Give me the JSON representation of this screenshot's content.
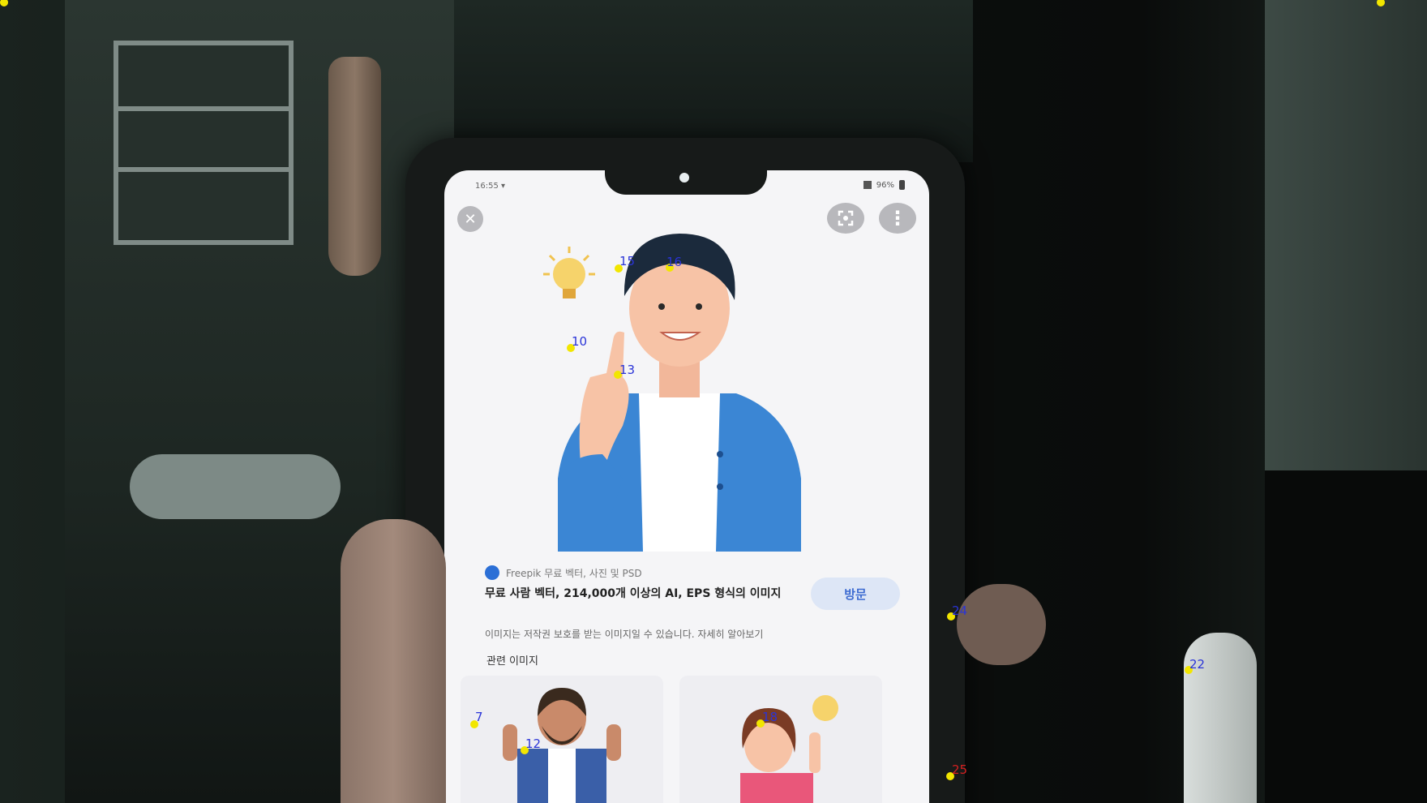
{
  "status_bar": {
    "time": "16:55 ▾",
    "battery": "96%"
  },
  "top_controls": {
    "close_symbol": "✕",
    "more_symbol": "⋮"
  },
  "result": {
    "source": "Freepik 무료 벡터, 사진 및 PSD",
    "title": "무료 사람 벡터, 214,000개 이상의 AI, EPS 형식의 이미지",
    "visit_label": "방문",
    "copyright_note": "이미지는 저작권 보호를 받는 이미지일 수 있습니다. 자세히 알아보기",
    "related_heading": "관련 이미지"
  },
  "markers": [
    {
      "label": "16"
    },
    {
      "label": "15"
    },
    {
      "label": "10"
    },
    {
      "label": "13"
    },
    {
      "label": "24"
    },
    {
      "label": "22"
    },
    {
      "label": "7"
    },
    {
      "label": "12"
    },
    {
      "label": "18"
    },
    {
      "label": "25"
    }
  ],
  "colors": {
    "marker_dot": "#f2e600",
    "marker_label": "#2a34d8",
    "marker_label_alt": "#d62020",
    "jacket_blue": "#3b86d4",
    "visit_button_bg": "#dde6f6"
  }
}
